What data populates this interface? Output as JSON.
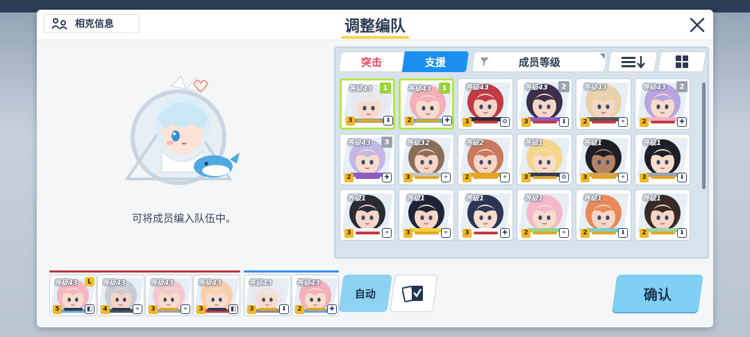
{
  "header": {
    "profile_label": "相克信息",
    "title": "调整编队"
  },
  "left_panel": {
    "empty_message": "可将成员编入队伍中。"
  },
  "tabs": [
    {
      "label": "突击",
      "active": false
    },
    {
      "label": "支援",
      "active": true
    }
  ],
  "sort": {
    "label": "成员等级"
  },
  "roster": [
    {
      "level": "等级43",
      "count": "1",
      "count_style": "green",
      "stars": "3",
      "stripe": "#e0a62a",
      "role": "⬇",
      "selected": true,
      "hair": "#e8e8ee",
      "skin": "#f6dccb",
      "accent": "#8a8e9a"
    },
    {
      "level": "等级43",
      "count": "1",
      "count_style": "green",
      "stars": "2",
      "stripe": "#e0a62a",
      "role": "✚",
      "selected": true,
      "hair": "#f3b0bb",
      "skin": "#f8dccc",
      "accent": "#6aa6d8"
    },
    {
      "level": "等级43",
      "count": "",
      "count_style": "",
      "stars": "3",
      "stripe": "#c23a44",
      "role": "⚙",
      "selected": false,
      "hair": "#c23a44",
      "skin": "#f6d6c6",
      "accent": "#2b2b3a"
    },
    {
      "level": "等级43",
      "count": "2",
      "count_style": "grey",
      "stars": "3",
      "stripe": "#c23a44",
      "role": "⬇",
      "selected": false,
      "hair": "#3a2e4a",
      "skin": "#f6d6c6",
      "accent": "#8a5cc4"
    },
    {
      "level": "等级43",
      "count": "",
      "count_style": "",
      "stars": "2",
      "stripe": "#c23a44",
      "role": "⌖",
      "selected": false,
      "hair": "#e6d2a8",
      "skin": "#f6d6c6",
      "accent": "#555"
    },
    {
      "level": "等级43",
      "count": "2",
      "count_style": "grey",
      "stars": "2",
      "stripe": "#c23a44",
      "role": "✚",
      "selected": false,
      "hair": "#b7a4e0",
      "skin": "#f8dccc",
      "accent": "#f3b0cc"
    },
    {
      "level": "等级43",
      "count": "3",
      "count_style": "grey",
      "stars": "2",
      "stripe": "#8a5cc4",
      "role": "✚",
      "selected": false,
      "hair": "#c4b6e6",
      "skin": "#f8dccc",
      "accent": "#8a5cc4"
    },
    {
      "level": "等级32",
      "count": "",
      "count_style": "",
      "stars": "3",
      "stripe": "#e0a62a",
      "role": "⌖",
      "selected": false,
      "hair": "#8a6e58",
      "skin": "#f6d6c6",
      "accent": "#c6c6c6"
    },
    {
      "level": "等级2",
      "count": "",
      "count_style": "",
      "stars": "2",
      "stripe": "#e0a62a",
      "role": "⌖",
      "selected": false,
      "hair": "#c87a5c",
      "skin": "#f6d6c6",
      "accent": "#e0a62a"
    },
    {
      "level": "等级1",
      "count": "",
      "count_style": "",
      "stars": "3",
      "stripe": "#e0a62a",
      "role": "⚙",
      "selected": false,
      "hair": "#f2d68a",
      "skin": "#f8dccc",
      "accent": "#3a3a52"
    },
    {
      "level": "等级1",
      "count": "",
      "count_style": "",
      "stars": "3",
      "stripe": "#e0a62a",
      "role": "⌖",
      "selected": false,
      "hair": "#1e1e26",
      "skin": "#b58465",
      "accent": "#d6a24a"
    },
    {
      "level": "等级1",
      "count": "",
      "count_style": "",
      "stars": "3",
      "stripe": "#e0a62a",
      "role": "⬇",
      "selected": false,
      "hair": "#1e1e26",
      "skin": "#f8dccc",
      "accent": "#9aa3ad"
    },
    {
      "level": "等级1",
      "count": "",
      "count_style": "",
      "stars": "3",
      "stripe": "#c23a44",
      "role": "⌖",
      "selected": false,
      "hair": "#2b2b36",
      "skin": "#f6d6c6",
      "accent": "#f2f2f2"
    },
    {
      "level": "等级1",
      "count": "",
      "count_style": "",
      "stars": "3",
      "stripe": "#e0a62a",
      "role": "⌖",
      "selected": false,
      "hair": "#1e2436",
      "skin": "#f6d6c6",
      "accent": "#f4d23a"
    },
    {
      "level": "等级1",
      "count": "",
      "count_style": "",
      "stars": "3",
      "stripe": "#c23a44",
      "role": "✚",
      "selected": false,
      "hair": "#2b3656",
      "skin": "#f8dccc",
      "accent": "#ffffff"
    },
    {
      "level": "等级1",
      "count": "",
      "count_style": "",
      "stars": "2",
      "stripe": "#e0a62a",
      "role": "⌖",
      "selected": false,
      "hair": "#f4b8c8",
      "skin": "#f8dccc",
      "accent": "#9bd48a"
    },
    {
      "level": "等级1",
      "count": "",
      "count_style": "",
      "stars": "2",
      "stripe": "#e0a62a",
      "role": "⬇",
      "selected": false,
      "hair": "#e9895a",
      "skin": "#f6d6c6",
      "accent": "#7bcfc8"
    },
    {
      "level": "等级1",
      "count": "",
      "count_style": "",
      "stars": "2",
      "stripe": "#e0a62a",
      "role": "⬇",
      "selected": false,
      "hair": "#3a2a24",
      "skin": "#f6d6c6",
      "accent": "#9bd4a8"
    }
  ],
  "team_groups": [
    {
      "color": "#b3363e"
    },
    {
      "color": "#2f8ee6"
    }
  ],
  "team": [
    {
      "level": "等级43",
      "stars": "5",
      "stripe": "#2b3b52",
      "role": "◧",
      "leader": "L",
      "hair": "#f3b8c4",
      "skin": "#f8dccc",
      "accent": "#6aa6d8"
    },
    {
      "level": "等级43",
      "stars": "4",
      "stripe": "#2b3b52",
      "role": "⌖",
      "leader": "",
      "hair": "#c8ccd6",
      "skin": "#f6d6c6",
      "accent": "#4a5466"
    },
    {
      "level": "等级43",
      "stars": "3",
      "stripe": "#e0a62a",
      "role": "⌖",
      "leader": "",
      "hair": "#f4c8d0",
      "skin": "#f8dccc",
      "accent": "#9aa3ad"
    },
    {
      "level": "等级43",
      "stars": "3",
      "stripe": "#2b3b52",
      "role": "◧",
      "leader": "",
      "hair": "#f6cfae",
      "skin": "#f8dccc",
      "accent": "#c23a44"
    },
    {
      "level": "等级43",
      "stars": "3",
      "stripe": "#e0a62a",
      "role": "⬇",
      "leader": "",
      "hair": "#e8e8ee",
      "skin": "#f6dccb",
      "accent": "#8a8e9a"
    },
    {
      "level": "等级43",
      "stars": "2",
      "stripe": "#e0a62a",
      "role": "✚",
      "leader": "",
      "hair": "#f3b0bb",
      "skin": "#f8dccc",
      "accent": "#6aa6d8"
    }
  ],
  "buttons": {
    "auto": "自动",
    "confirm": "确认"
  },
  "colors": {
    "accent_blue": "#1a8ff0",
    "striker_red": "#e0455f",
    "selected_green": "#b6e64a",
    "confirm_bg": "#7fd0f4"
  },
  "icons": {
    "close": "close-icon",
    "profile": "profile-info-icon",
    "filter": "filter-icon",
    "order": "sort-order-icon",
    "grid": "grid-view-icon",
    "deck": "card-deck-icon"
  }
}
